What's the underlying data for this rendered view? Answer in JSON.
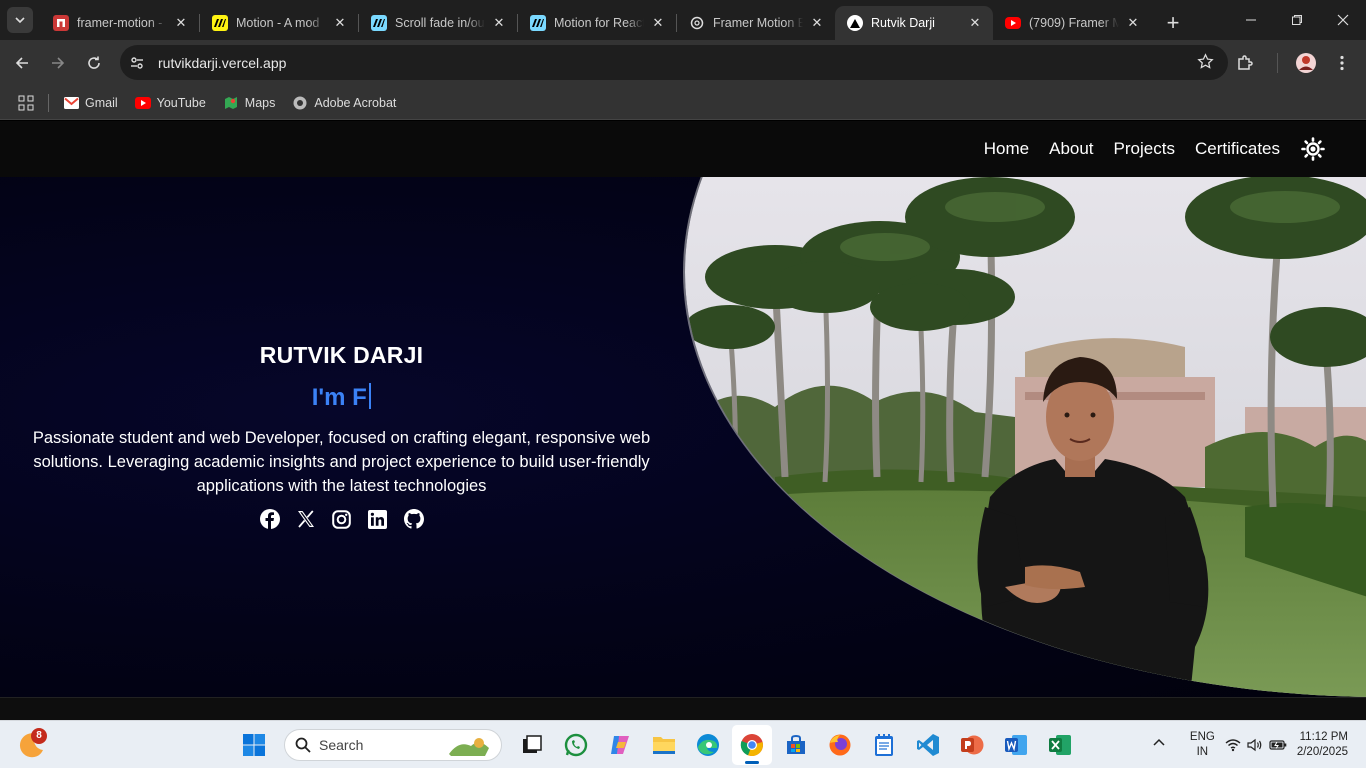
{
  "browser": {
    "tabs": [
      {
        "title": "framer-motion -",
        "icon": "npm-icon",
        "color": "#cb3837",
        "glyph": "n"
      },
      {
        "title": "Motion - A mod",
        "icon": "motion-icon",
        "color": "#fff312",
        "glyph": ""
      },
      {
        "title": "Scroll fade in/ou",
        "icon": "motion-icon",
        "color": "#7ad9ff",
        "glyph": ""
      },
      {
        "title": "Motion for React",
        "icon": "motion-icon",
        "color": "#7ad9ff",
        "glyph": ""
      },
      {
        "title": "Framer Motion E",
        "icon": "chatgpt-icon",
        "color": "#222222",
        "glyph": ""
      },
      {
        "title": "Rutvik Darji",
        "icon": "vercel-icon",
        "color": "#000000",
        "glyph": ""
      },
      {
        "title": "(7909) Framer M",
        "icon": "youtube-icon",
        "color": "#ff0000",
        "glyph": ""
      }
    ],
    "active_tab": 5,
    "url": "rutvikdarji.vercel.app",
    "bookmarks": [
      {
        "label": "Gmail",
        "icon": "gmail-icon"
      },
      {
        "label": "YouTube",
        "icon": "youtube-icon"
      },
      {
        "label": "Maps",
        "icon": "maps-icon"
      },
      {
        "label": "Adobe Acrobat",
        "icon": "acrobat-icon"
      }
    ]
  },
  "site": {
    "nav": [
      {
        "label": "Home"
      },
      {
        "label": "About"
      },
      {
        "label": "Projects"
      },
      {
        "label": "Certificates"
      }
    ],
    "theme_toggle_icon": "sun-icon",
    "hero": {
      "name": "RUTVIK DARJI",
      "typing_text": "I'm F",
      "bio": "Passionate student and web Developer, focused on crafting elegant, responsive web solutions. Leveraging academic insights and project experience to build user-friendly applications with the latest technologies",
      "socials": [
        "facebook-icon",
        "x-icon",
        "instagram-icon",
        "linkedin-icon",
        "github-icon"
      ],
      "accent_color": "#3b82f6"
    }
  },
  "taskbar": {
    "widget_badge": "8",
    "search_placeholder": "Search",
    "apps": [
      "start-icon",
      "task-view-icon",
      "whatsapp-icon",
      "copilot-icon",
      "file-explorer-icon",
      "edge-icon",
      "chrome-icon",
      "store-icon",
      "firefox-icon",
      "notepad-icon",
      "vscode-icon",
      "powerpoint-icon",
      "word-icon",
      "excel-icon"
    ],
    "language_line1": "ENG",
    "language_line2": "IN",
    "time": "11:12 PM",
    "date": "2/20/2025"
  }
}
